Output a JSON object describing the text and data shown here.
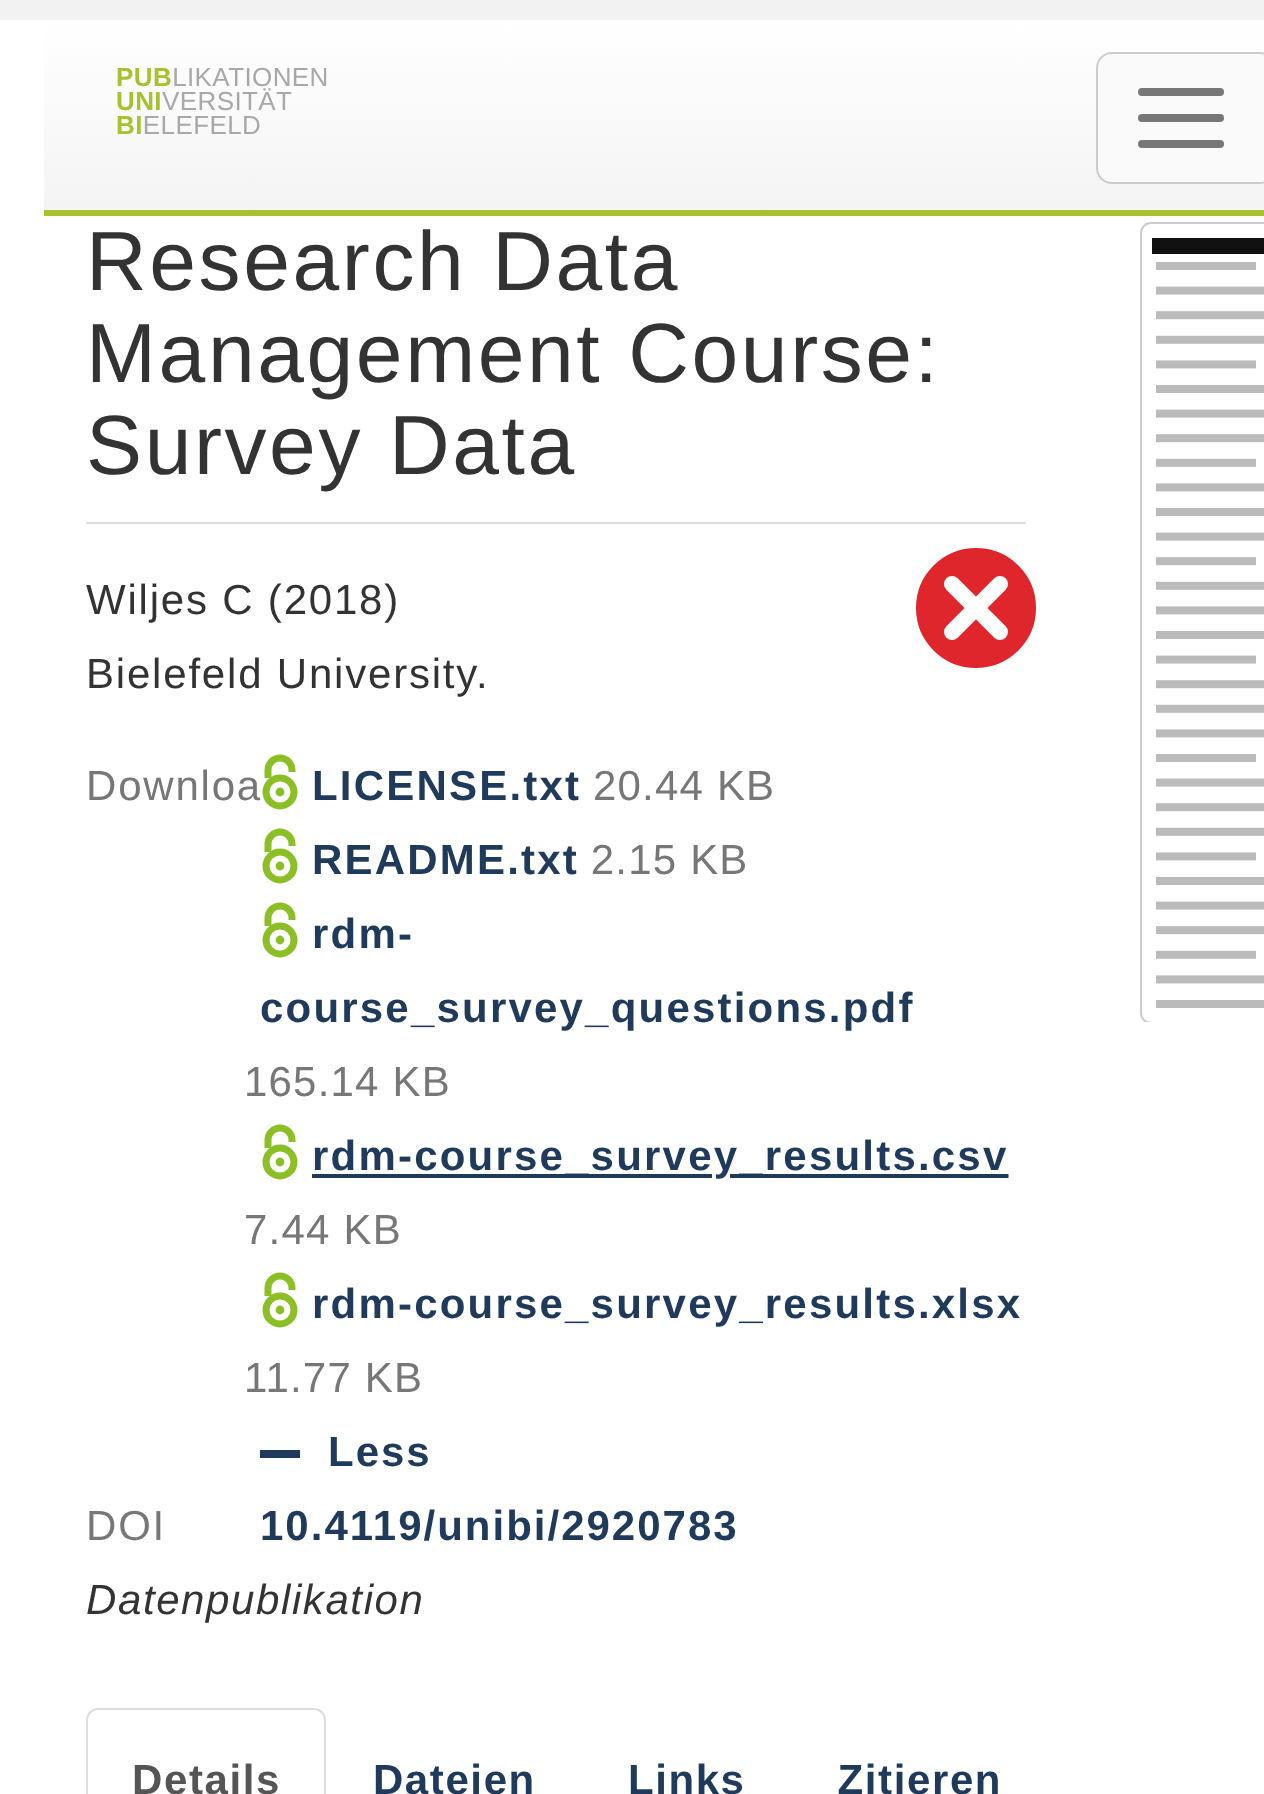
{
  "header": {
    "logo": [
      {
        "strong": "PUB",
        "light": "LIKATIONEN"
      },
      {
        "strong": "UNI",
        "light": "VERSITÄT"
      },
      {
        "strong": "BI",
        "light": "ELEFELD"
      }
    ],
    "menu_button": {
      "kind": "hamburger"
    }
  },
  "title": "Research Data Management Course: Survey Data",
  "citation": {
    "authors": "Wiljes C (2018)",
    "publisher": "Bielefeld University.",
    "error": true
  },
  "download": {
    "label": "Downloa",
    "files": [
      {
        "name": "LICENSE.txt",
        "size": "20.44 KB",
        "hovered": false
      },
      {
        "name": "README.txt",
        "size": "2.15 KB",
        "hovered": false
      },
      {
        "name": "rdm-course_survey_questions.pdf",
        "size": "165.14 KB",
        "hovered": false
      },
      {
        "name": "rdm-course_survey_results.csv",
        "size": "7.44 KB",
        "hovered": true
      },
      {
        "name": "rdm-course_survey_results.xlsx",
        "size": "11.77 KB",
        "hovered": false
      }
    ],
    "toggle": "Less",
    "expanded": true
  },
  "doi": {
    "label": "DOI",
    "value": "10.4119/unibi/2920783"
  },
  "type": "Datenpublikation",
  "tabs": [
    {
      "label": "Details",
      "selected": true
    },
    {
      "label": "Dateien",
      "selected": false
    },
    {
      "label": "Links",
      "selected": false
    },
    {
      "label": "Zitieren",
      "selected": false
    }
  ]
}
